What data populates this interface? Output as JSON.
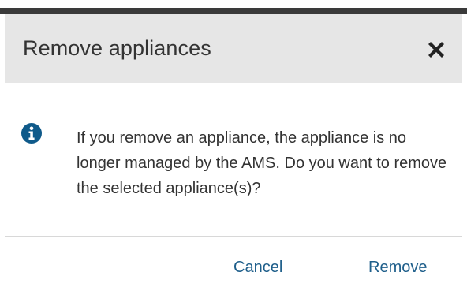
{
  "dialog": {
    "title": "Remove appliances",
    "message": "If you remove an appliance, the appliance is no longer managed by the AMS. Do you want to remove the selected appliance(s)?",
    "icons": {
      "close": "close-icon",
      "info": "info-icon"
    },
    "buttons": {
      "cancel_label": "Cancel",
      "remove_label": "Remove"
    },
    "colors": {
      "header_bg": "#e6e6e6",
      "info_icon": "#0f5a8a",
      "button_text": "#1f5f8b",
      "top_bar": "#3a3a3a"
    }
  }
}
